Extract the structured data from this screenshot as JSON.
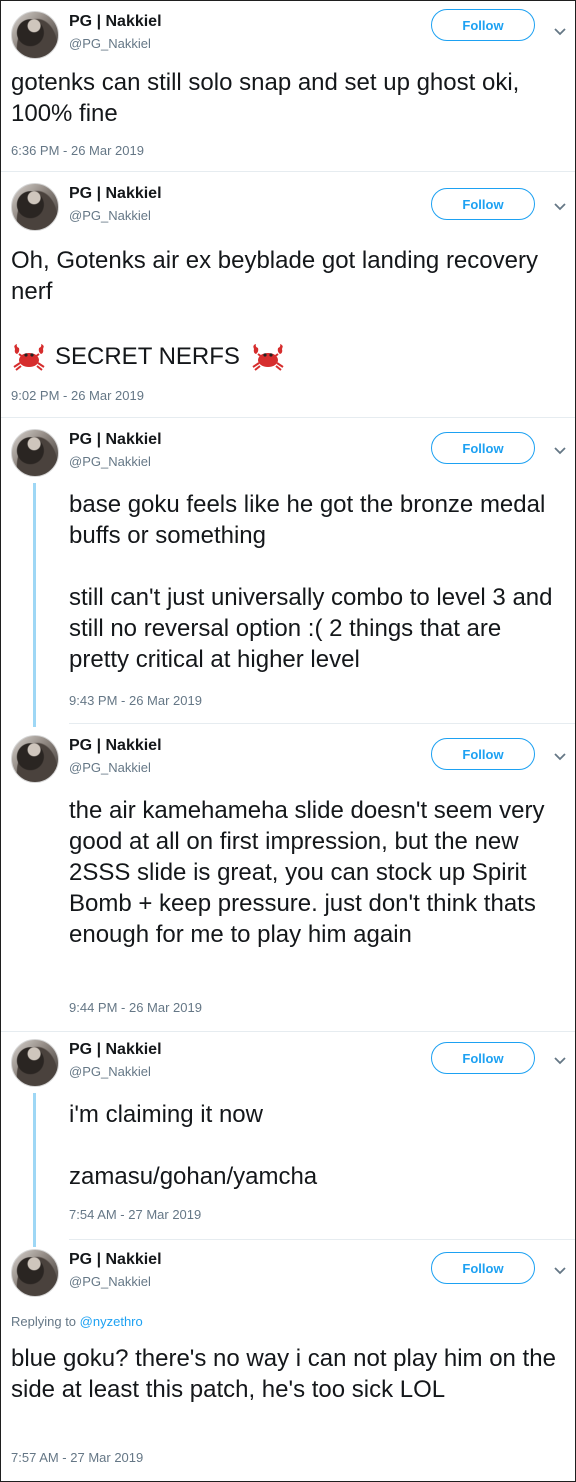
{
  "colors": {
    "accent": "#1da1f2",
    "thread_line": "#9ed7f5",
    "muted": "#657786",
    "text": "#14171a"
  },
  "icons": {
    "chevron": "chevron-down-icon",
    "crab": "crab-emoji-icon"
  },
  "tweets": [
    {
      "name": "PG | Nakkiel",
      "handle": "@PG_Nakkiel",
      "follow_label": "Follow",
      "text": "gotenks can still solo snap and set up ghost oki, 100% fine",
      "timestamp": "6:36 PM - 26 Mar 2019"
    },
    {
      "name": "PG | Nakkiel",
      "handle": "@PG_Nakkiel",
      "follow_label": "Follow",
      "text": "Oh, Gotenks air ex beyblade got landing recovery nerf",
      "emoji_line": "SECRET NERFS",
      "timestamp": "9:02 PM - 26 Mar 2019"
    },
    {
      "name": "PG | Nakkiel",
      "handle": "@PG_Nakkiel",
      "follow_label": "Follow",
      "text": "base goku feels like he got the bronze medal buffs or something\n\nstill can't just universally combo to level 3 and still no reversal option :( 2 things that are pretty critical at higher level",
      "timestamp": "9:43 PM - 26 Mar 2019"
    },
    {
      "name": "PG | Nakkiel",
      "handle": "@PG_Nakkiel",
      "follow_label": "Follow",
      "text": "the air kamehameha slide doesn't seem very good at all on first impression, but the new 2SSS slide is great, you can stock up Spirit Bomb + keep pressure. just don't think thats enough for me to play him again",
      "timestamp": "9:44 PM - 26 Mar 2019"
    },
    {
      "name": "PG | Nakkiel",
      "handle": "@PG_Nakkiel",
      "follow_label": "Follow",
      "text": "i'm claiming it now\n\nzamasu/gohan/yamcha",
      "timestamp": "7:54 AM - 27 Mar 2019"
    },
    {
      "name": "PG | Nakkiel",
      "handle": "@PG_Nakkiel",
      "follow_label": "Follow",
      "replying_label": "Replying to",
      "replying_handle": "@nyzethro",
      "text": "blue goku? there's no way i can not play him on the side at least this patch, he's too sick LOL",
      "timestamp": "7:57 AM - 27 Mar 2019"
    }
  ]
}
